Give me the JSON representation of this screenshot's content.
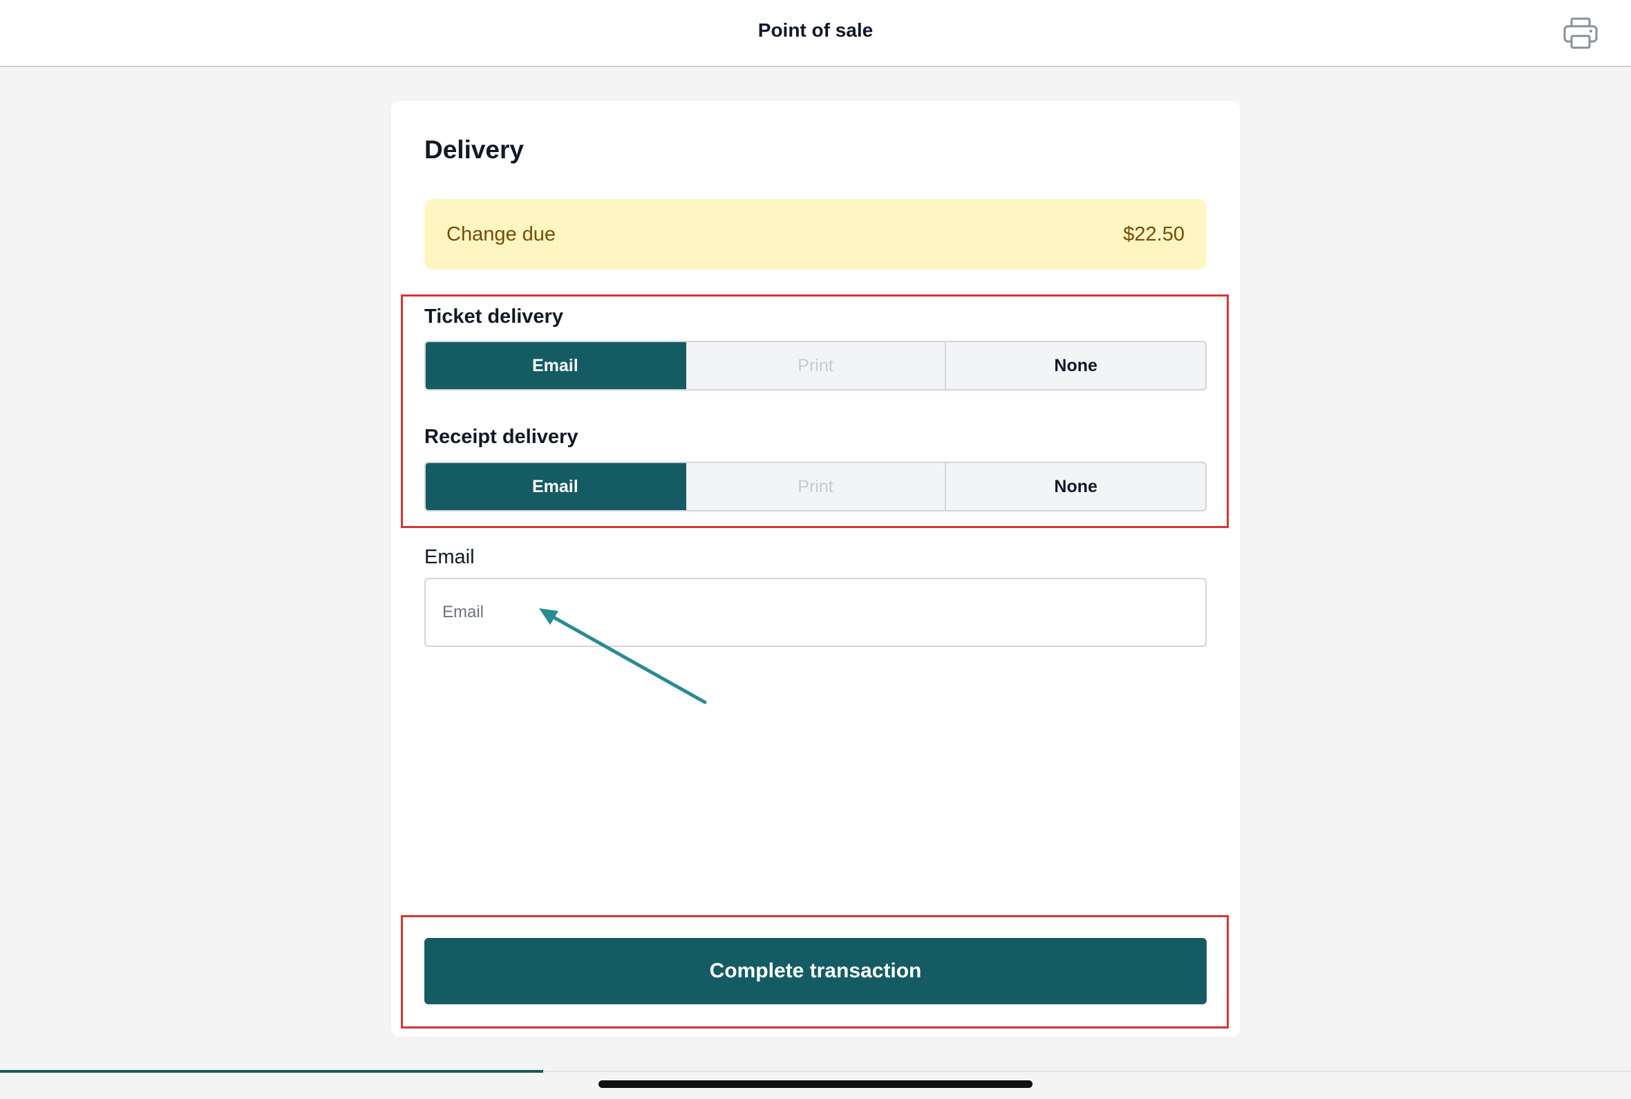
{
  "header": {
    "title": "Point of sale",
    "print_icon": "printer-icon"
  },
  "delivery": {
    "title": "Delivery",
    "change_due": {
      "label": "Change due",
      "amount": "$22.50"
    },
    "ticket": {
      "label": "Ticket delivery",
      "options": [
        "Email",
        "Print",
        "None"
      ],
      "selected": "Email",
      "disabled": [
        "Print"
      ]
    },
    "receipt": {
      "label": "Receipt delivery",
      "options": [
        "Email",
        "Print",
        "None"
      ],
      "selected": "Email",
      "disabled": [
        "Print"
      ]
    },
    "email": {
      "label": "Email",
      "placeholder": "Email",
      "value": ""
    },
    "complete_label": "Complete transaction"
  },
  "colors": {
    "accent": "#155b63",
    "highlight": "#d93333",
    "annotation_arrow": "#2a8a94",
    "change_due_bg": "#fdf6c3",
    "change_due_text": "#7a4a06"
  },
  "progress": {
    "fraction": 0.333
  }
}
